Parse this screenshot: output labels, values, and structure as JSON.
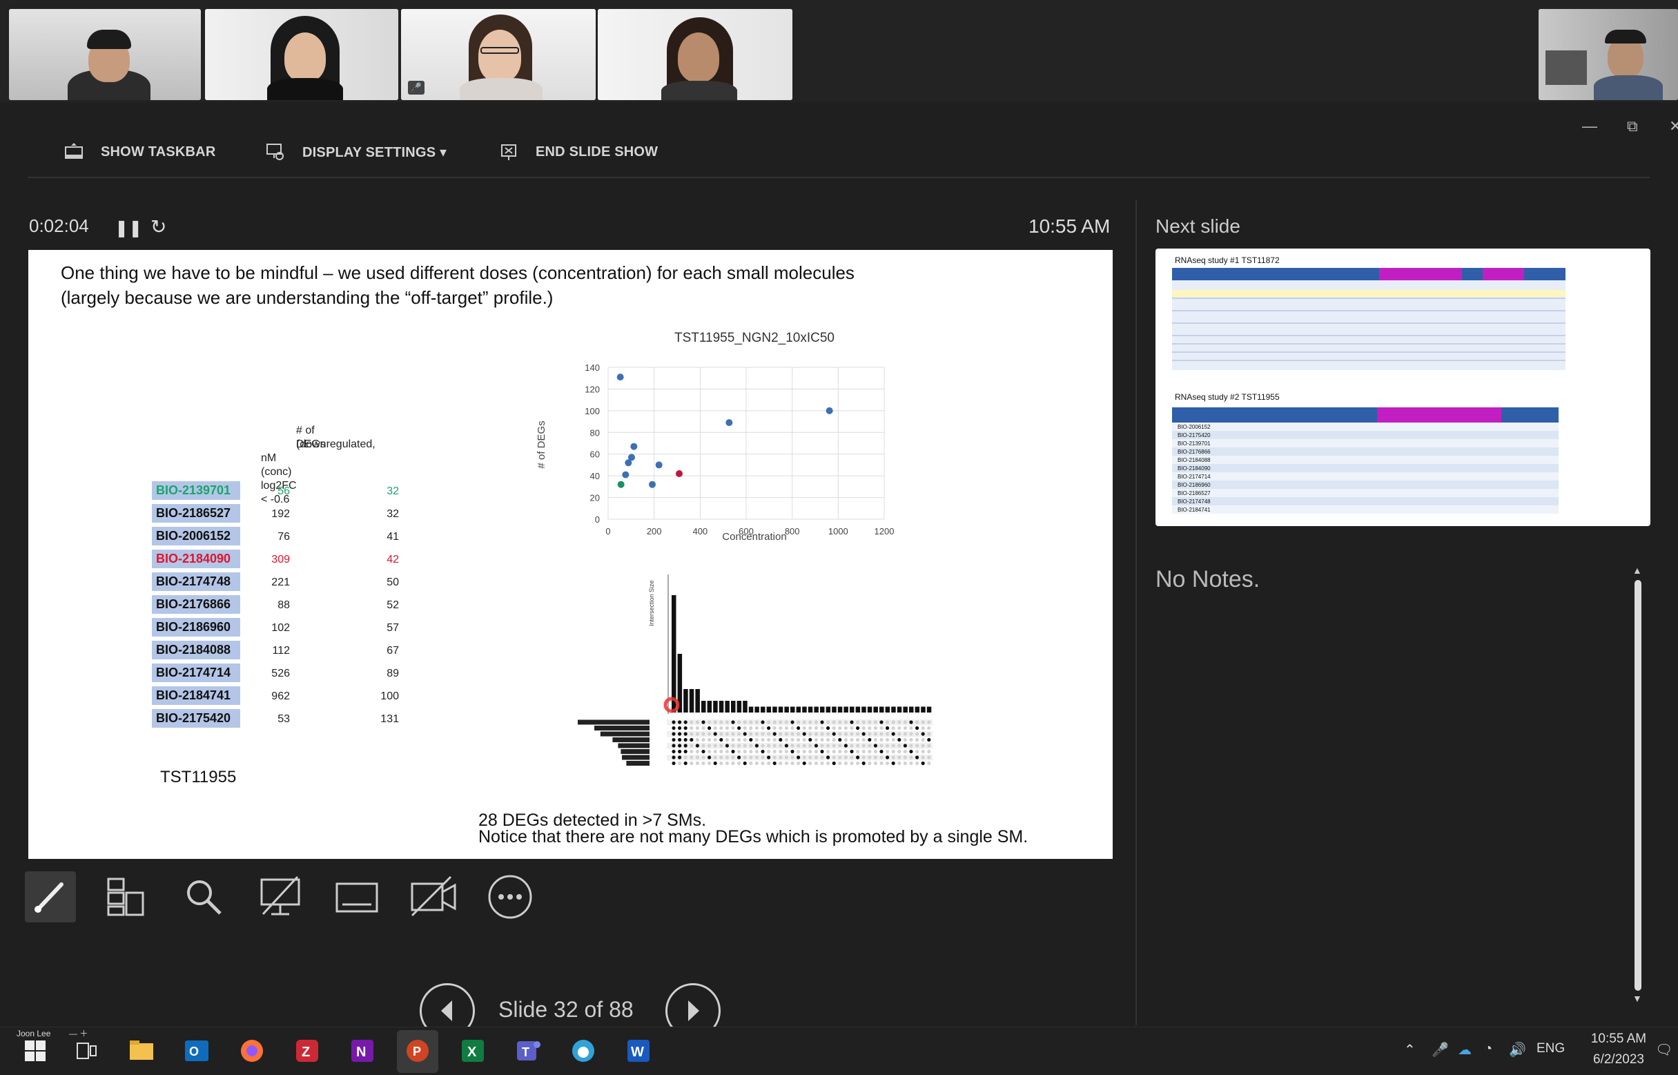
{
  "participants": [
    {
      "name": "participant-1",
      "active": true,
      "muted": false
    },
    {
      "name": "participant-2",
      "active": false,
      "muted": false
    },
    {
      "name": "participant-3",
      "active": false,
      "muted": true
    },
    {
      "name": "participant-4",
      "active": false,
      "muted": false
    },
    {
      "name": "participant-self",
      "active": false,
      "muted": false
    }
  ],
  "toolbar": {
    "show_taskbar": "SHOW TASKBAR",
    "display_settings": "DISPLAY SETTINGS ▾",
    "end_slide_show": "END SLIDE SHOW"
  },
  "presenter": {
    "timer": "0:02:04",
    "clock": "10:55 AM",
    "next_slide_label": "Next slide",
    "notes": "No Notes.",
    "slide_counter": "Slide 32 of 88"
  },
  "slide": {
    "title_line1": "One thing we have to be mindful – we used different doses (concentration) for each small molecules",
    "title_line2": "(largely because we are understanding the “off-target” profile.)",
    "table_header_degs_1": "# of DEGs",
    "table_header_degs_2": "(downregulated,",
    "table_header_conc": "nM (conc) log2FC < -0.6",
    "rows": [
      {
        "compound": "BIO-2139701",
        "conc": "56",
        "degs": "32",
        "style": "green"
      },
      {
        "compound": "BIO-2186527",
        "conc": "192",
        "degs": "32",
        "style": "normal"
      },
      {
        "compound": "BIO-2006152",
        "conc": "76",
        "degs": "41",
        "style": "normal"
      },
      {
        "compound": "BIO-2184090",
        "conc": "309",
        "degs": "42",
        "style": "red"
      },
      {
        "compound": "BIO-2174748",
        "conc": "221",
        "degs": "50",
        "style": "normal"
      },
      {
        "compound": "BIO-2176866",
        "conc": "88",
        "degs": "52",
        "style": "normal"
      },
      {
        "compound": "BIO-2186960",
        "conc": "102",
        "degs": "57",
        "style": "normal"
      },
      {
        "compound": "BIO-2184088",
        "conc": "112",
        "degs": "67",
        "style": "normal"
      },
      {
        "compound": "BIO-2174714",
        "conc": "526",
        "degs": "89",
        "style": "normal"
      },
      {
        "compound": "BIO-2184741",
        "conc": "962",
        "degs": "100",
        "style": "normal"
      },
      {
        "compound": "BIO-2175420",
        "conc": "53",
        "degs": "131",
        "style": "normal"
      }
    ],
    "tst_label": "TST11955",
    "caption_line1": "28 DEGs detected in >7 SMs.",
    "caption_line2": "Notice that there are not many DEGs which is promoted by a single SM.",
    "upset_ylabel": "Intersection Size"
  },
  "chart_data": {
    "type": "scatter",
    "title": "TST11955_NGN2_10xIC50",
    "xlabel": "Concentration",
    "ylabel": "# of DEGs",
    "xlim": [
      0,
      1200
    ],
    "ylim": [
      0,
      140
    ],
    "xticks": [
      0,
      200,
      400,
      600,
      800,
      1000,
      1200
    ],
    "yticks": [
      0,
      20,
      40,
      60,
      80,
      100,
      120,
      140
    ],
    "grid": true,
    "points": [
      {
        "x": 56,
        "y": 32,
        "color": "#1a8f6a"
      },
      {
        "x": 192,
        "y": 32,
        "color": "#3d6fb5"
      },
      {
        "x": 76,
        "y": 41,
        "color": "#3d6fb5"
      },
      {
        "x": 309,
        "y": 42,
        "color": "#c0143c"
      },
      {
        "x": 221,
        "y": 50,
        "color": "#3d6fb5"
      },
      {
        "x": 88,
        "y": 52,
        "color": "#3d6fb5"
      },
      {
        "x": 102,
        "y": 57,
        "color": "#3d6fb5"
      },
      {
        "x": 112,
        "y": 67,
        "color": "#3d6fb5"
      },
      {
        "x": 526,
        "y": 89,
        "color": "#3d6fb5"
      },
      {
        "x": 962,
        "y": 100,
        "color": "#3d6fb5"
      },
      {
        "x": 53,
        "y": 131,
        "color": "#3d6fb5"
      }
    ]
  },
  "next_slide": {
    "title1": "RNAseq study #1 TST11872",
    "title2": "RNAseq study #2 TST11955",
    "rows2": [
      "BIO-2006152",
      "BIO-2175420",
      "BIO-2139701",
      "BIO-2176866",
      "BIO-2184088",
      "BIO-2184090",
      "BIO-2174714",
      "BIO-2186960",
      "BIO-2186527",
      "BIO-2174748",
      "BIO-2184741"
    ]
  },
  "taskbar": {
    "user_label": "Joon Lee",
    "lang": "ENG",
    "time": "10:55 AM",
    "date": "6/2/2023"
  }
}
